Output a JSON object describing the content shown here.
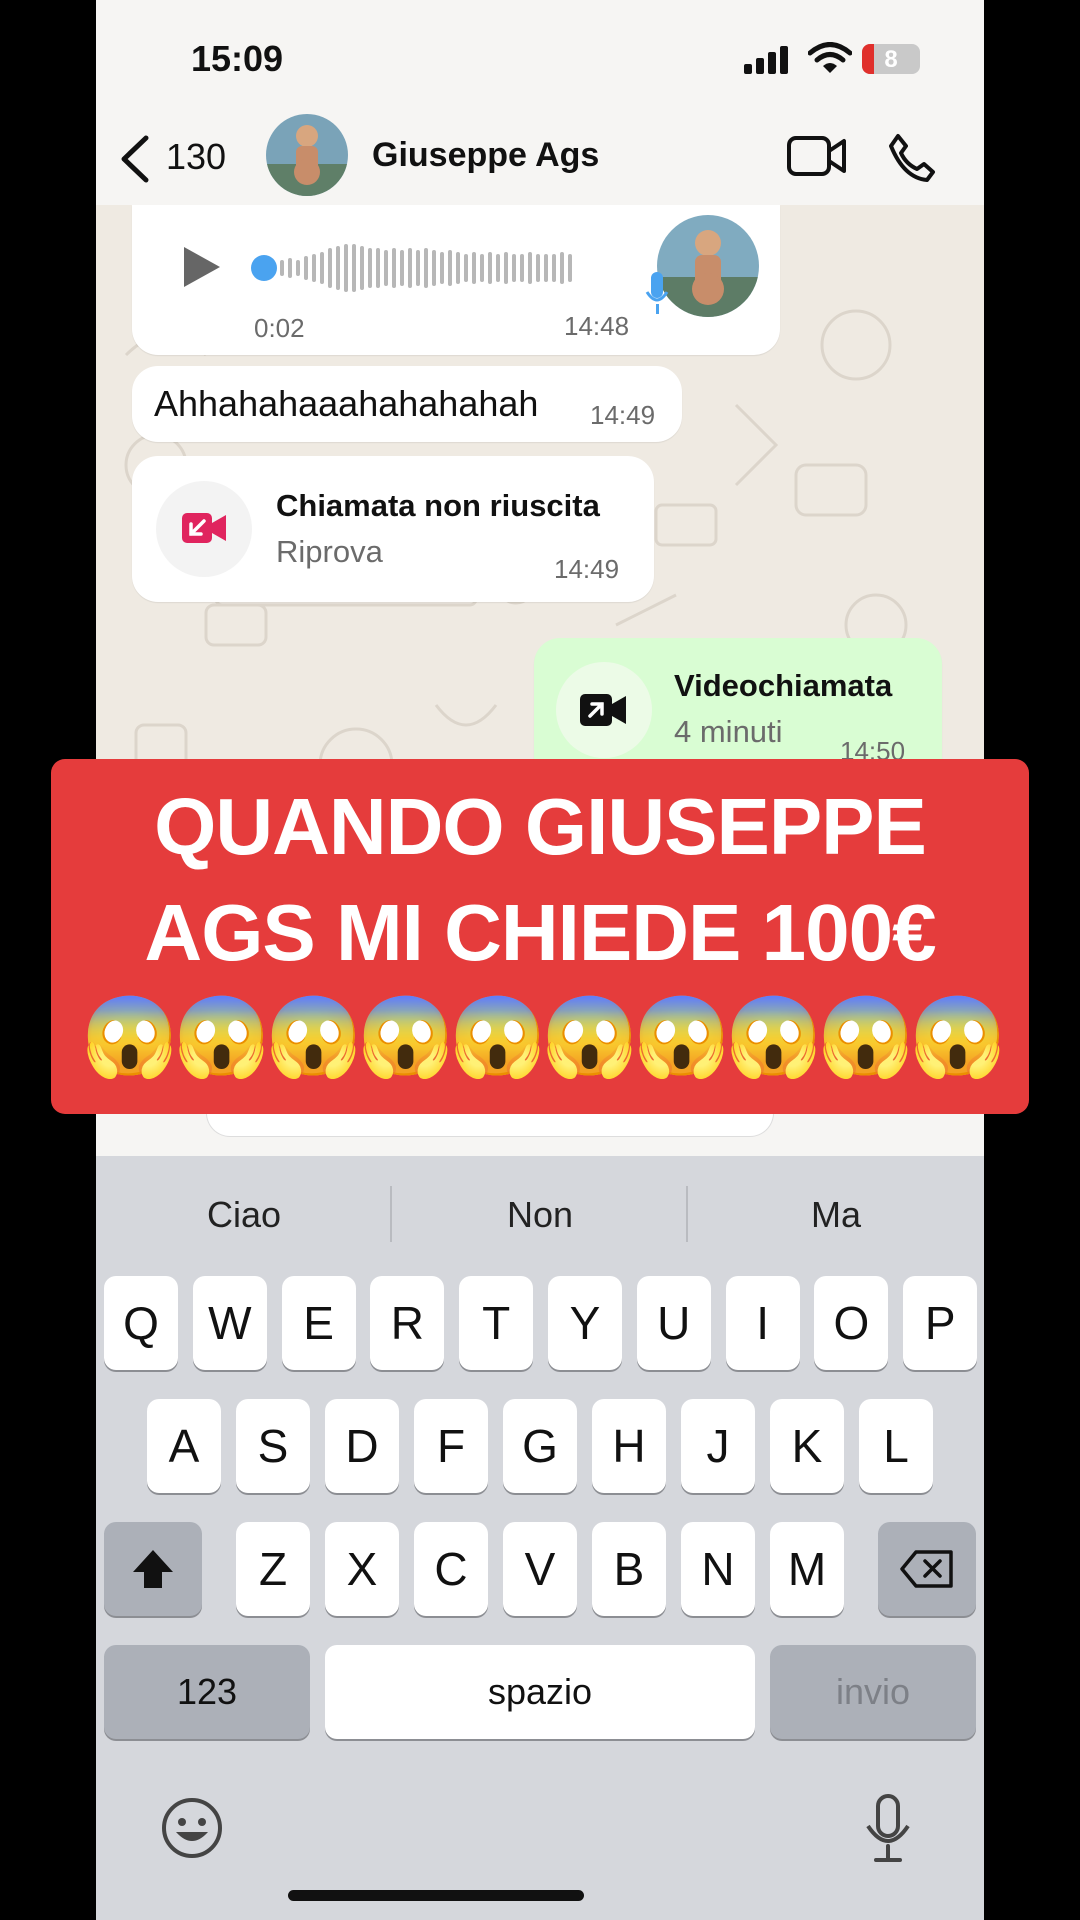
{
  "status": {
    "time": "15:09",
    "battery": "8"
  },
  "header": {
    "back_count": "130",
    "contact_name": "Giuseppe Ags"
  },
  "messages": {
    "voice": {
      "duration": "0:02",
      "time": "14:48"
    },
    "text": {
      "body": "Ahhahahaaahahahahah",
      "time": "14:49"
    },
    "missed_call": {
      "title": "Chiamata non riuscita",
      "action": "Riprova",
      "time": "14:49"
    },
    "video_call": {
      "title": "Videochiamata",
      "duration": "4 minuti",
      "time": "14:50"
    }
  },
  "overlay": {
    "line1": "QUANDO GIUSEPPE",
    "line2": "AGS MI CHIEDE 100€",
    "emoji": "😱"
  },
  "keyboard": {
    "suggestions": [
      "Ciao",
      "Non",
      "Ma"
    ],
    "row1": [
      "Q",
      "W",
      "E",
      "R",
      "T",
      "Y",
      "U",
      "I",
      "O",
      "P"
    ],
    "row2": [
      "A",
      "S",
      "D",
      "F",
      "G",
      "H",
      "J",
      "K",
      "L"
    ],
    "row3": [
      "Z",
      "X",
      "C",
      "V",
      "B",
      "N",
      "M"
    ],
    "numbers_label": "123",
    "space_label": "spazio",
    "return_label": "invio"
  },
  "colors": {
    "banner": "#e53c3c",
    "outgoing_bubble": "#d9fdd3",
    "missed_call_red": "#e0245e"
  }
}
